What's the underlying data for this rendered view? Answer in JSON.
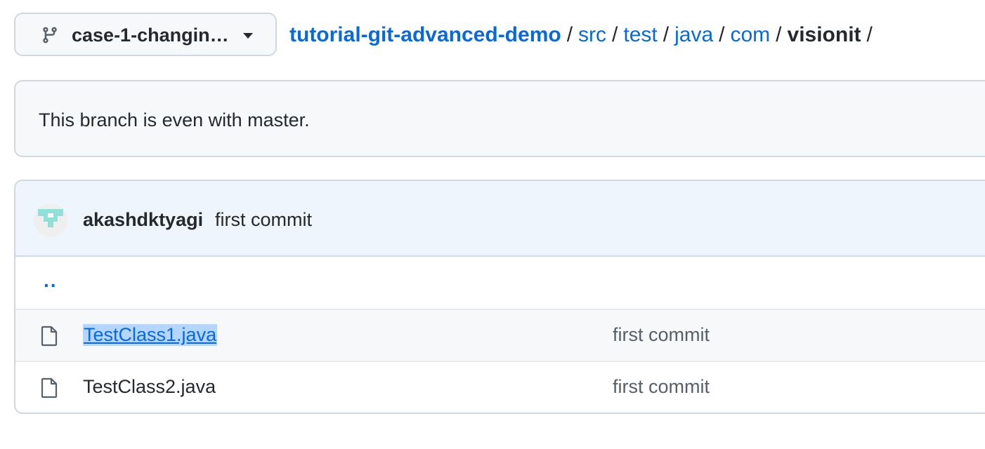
{
  "branch": {
    "name": "case-1-changin…",
    "icon": "git-branch-icon"
  },
  "breadcrumb": {
    "repo": "tutorial-git-advanced-demo",
    "parts": [
      "src",
      "test",
      "java",
      "com"
    ],
    "current": "visionit",
    "separator": "/"
  },
  "compare": {
    "message": "This branch is even with master."
  },
  "latest_commit": {
    "author": "akashdktyagi",
    "message": "first commit"
  },
  "files": {
    "parent_link": "..",
    "rows": [
      {
        "name": "TestClass1.java",
        "commit": "first commit",
        "icon": "file-icon",
        "selected": true
      },
      {
        "name": "TestClass2.java",
        "commit": "first commit",
        "icon": "file-icon",
        "selected": false
      }
    ]
  },
  "colors": {
    "link": "#0969da",
    "text": "#24292f",
    "muted": "#57606a",
    "header_bg": "#eef5fd",
    "selection": "#b4d5fe"
  }
}
